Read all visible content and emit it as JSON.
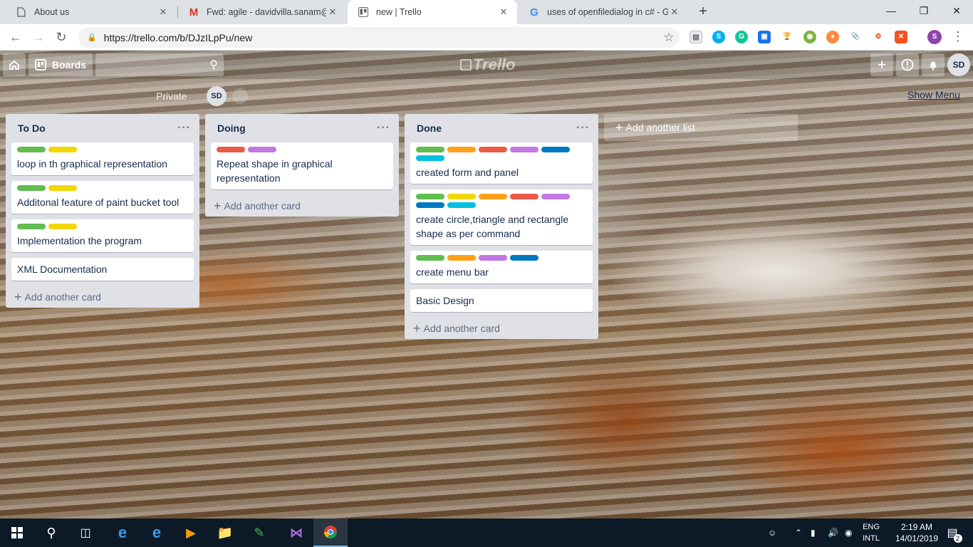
{
  "browser": {
    "tabs": [
      {
        "title": "About us",
        "icon": "document-icon"
      },
      {
        "title": "Fwd: agile - davidvilla.sanam@gr",
        "icon": "gmail-icon"
      },
      {
        "title": "new | Trello",
        "icon": "trello-icon"
      },
      {
        "title": "uses of openfiledialog in c# - Go",
        "icon": "google-icon"
      }
    ],
    "tab_close": "✕",
    "new_tab": "+",
    "url": "https://trello.com/b/DJzILpPu/new",
    "window": {
      "minimize": "—",
      "maximize": "❐",
      "close": "✕"
    }
  },
  "trello": {
    "boards_label": "Boards",
    "logo_text": "Trello",
    "user_initials": "SD",
    "board": {
      "visibility": "Private",
      "member_initials": "SD",
      "show_menu": "Show Menu"
    },
    "lists": [
      {
        "title": "To Do",
        "cards": [
          {
            "text": "loop in th graphical representation",
            "labels": [
              "#61bd4f",
              "#f2d600"
            ]
          },
          {
            "text": "Additonal feature of paint bucket tool",
            "labels": [
              "#61bd4f",
              "#f2d600"
            ]
          },
          {
            "text": "Implementation the program",
            "labels": [
              "#61bd4f",
              "#f2d600"
            ]
          },
          {
            "text": "XML Documentation",
            "labels": []
          }
        ]
      },
      {
        "title": "Doing",
        "cards": [
          {
            "text": "Repeat shape in graphical representation",
            "labels": [
              "#eb5a46",
              "#c377e0"
            ]
          }
        ]
      },
      {
        "title": "Done",
        "cards": [
          {
            "text": "created form and panel",
            "labels": [
              "#61bd4f",
              "#ff9f1a",
              "#eb5a46",
              "#c377e0",
              "#0079bf",
              "#00c2e0"
            ]
          },
          {
            "text": "create circle,triangle and rectangle shape as per command",
            "labels": [
              "#61bd4f",
              "#f2d600",
              "#ff9f1a",
              "#eb5a46",
              "#c377e0",
              "#0079bf",
              "#00c2e0"
            ]
          },
          {
            "text": "create menu bar",
            "labels": [
              "#61bd4f",
              "#ff9f1a",
              "#c377e0",
              "#0079bf"
            ]
          },
          {
            "text": "Basic Design",
            "labels": []
          }
        ]
      }
    ],
    "list_menu": "···",
    "add_card_label": "Add another card",
    "add_list_label": "Add another list"
  },
  "taskbar": {
    "lang_line1": "ENG",
    "lang_line2": "INTL",
    "time": "2:19 AM",
    "date": "14/01/2019",
    "notification_count": "2"
  }
}
